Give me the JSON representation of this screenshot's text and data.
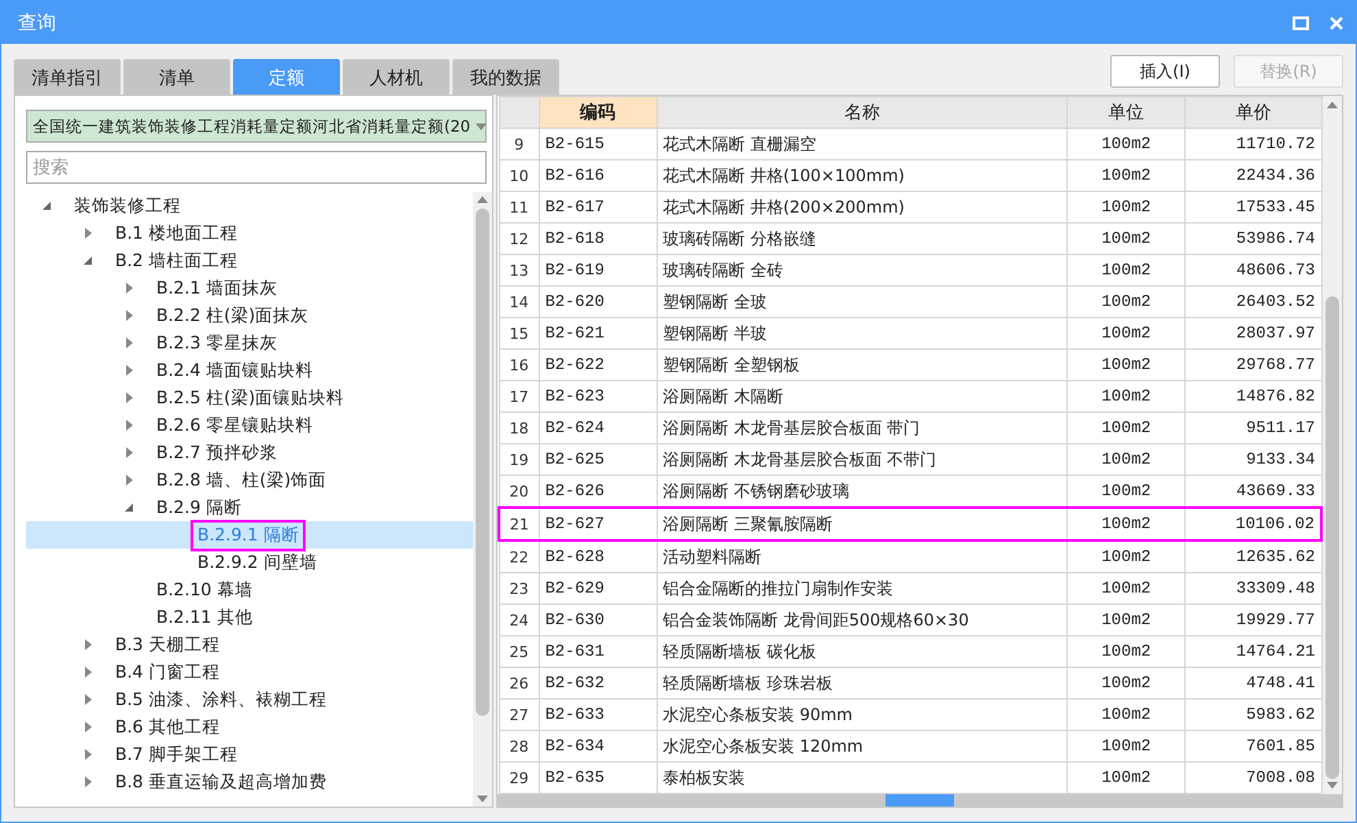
{
  "window": {
    "title": "查询"
  },
  "tabs": [
    {
      "label": "清单指引",
      "selected": false
    },
    {
      "label": "清单",
      "selected": false
    },
    {
      "label": "定额",
      "selected": true
    },
    {
      "label": "人材机",
      "selected": false
    },
    {
      "label": "我的数据",
      "selected": false
    }
  ],
  "buttons": [
    {
      "label": "插入(I)",
      "disabled": false
    },
    {
      "label": "替换(R)",
      "disabled": true
    }
  ],
  "library": {
    "value": "全国统一建筑装饰装修工程消耗量定额河北省消耗量定额(20"
  },
  "search": {
    "placeholder": "搜索"
  },
  "tree": [
    {
      "label": "装饰装修工程",
      "expanded": true,
      "selected": false,
      "marked": false,
      "children": [
        {
          "label": "B.1 楼地面工程",
          "expanded": false,
          "selected": false,
          "marked": false
        },
        {
          "label": "B.2 墙柱面工程",
          "expanded": true,
          "selected": false,
          "marked": false,
          "children": [
            {
              "label": "B.2.1 墙面抹灰",
              "expanded": false,
              "selected": false,
              "marked": false
            },
            {
              "label": "B.2.2 柱(梁)面抹灰",
              "expanded": false,
              "selected": false,
              "marked": false
            },
            {
              "label": "B.2.3 零星抹灰",
              "expanded": false,
              "selected": false,
              "marked": false
            },
            {
              "label": "B.2.4 墙面镶贴块料",
              "expanded": false,
              "selected": false,
              "marked": false
            },
            {
              "label": "B.2.5 柱(梁)面镶贴块料",
              "expanded": false,
              "selected": false,
              "marked": false
            },
            {
              "label": "B.2.6 零星镶贴块料",
              "expanded": false,
              "selected": false,
              "marked": false
            },
            {
              "label": "B.2.7 预拌砂浆",
              "expanded": false,
              "selected": false,
              "marked": false
            },
            {
              "label": "B.2.8 墙、柱(梁)饰面",
              "expanded": false,
              "selected": false,
              "marked": false
            },
            {
              "label": "B.2.9 隔断",
              "expanded": true,
              "selected": false,
              "marked": false,
              "children": [
                {
                  "label": "B.2.9.1 隔断",
                  "selected": true,
                  "marked": true
                },
                {
                  "label": "B.2.9.2 间壁墙",
                  "selected": false,
                  "marked": false
                }
              ]
            },
            {
              "label": "B.2.10 幕墙",
              "selected": false,
              "marked": false
            },
            {
              "label": "B.2.11 其他",
              "selected": false,
              "marked": false
            }
          ]
        },
        {
          "label": "B.3 天棚工程",
          "expanded": false,
          "selected": false,
          "marked": false
        },
        {
          "label": "B.4 门窗工程",
          "expanded": false,
          "selected": false,
          "marked": false
        },
        {
          "label": "B.5 油漆、涂料、裱糊工程",
          "expanded": false,
          "selected": false,
          "marked": false
        },
        {
          "label": "B.6 其他工程",
          "expanded": false,
          "selected": false,
          "marked": false
        },
        {
          "label": "B.7 脚手架工程",
          "expanded": false,
          "selected": false,
          "marked": false
        },
        {
          "label": "B.8 垂直运输及超高增加费",
          "expanded": false,
          "selected": false,
          "marked": false
        }
      ]
    }
  ],
  "table": {
    "columns": [
      {
        "label": "编码",
        "selected": true
      },
      {
        "label": "名称",
        "selected": false
      },
      {
        "label": "单位",
        "selected": false
      },
      {
        "label": "单价",
        "selected": false
      }
    ],
    "rows": [
      {
        "index": "9",
        "code": "B2-615",
        "name": "花式木隔断 直栅漏空",
        "unit": "100m2",
        "price": "11710.72",
        "marked": false
      },
      {
        "index": "10",
        "code": "B2-616",
        "name": "花式木隔断 井格(100×100mm)",
        "unit": "100m2",
        "price": "22434.36",
        "marked": false
      },
      {
        "index": "11",
        "code": "B2-617",
        "name": "花式木隔断 井格(200×200mm)",
        "unit": "100m2",
        "price": "17533.45",
        "marked": false
      },
      {
        "index": "12",
        "code": "B2-618",
        "name": "玻璃砖隔断 分格嵌缝",
        "unit": "100m2",
        "price": "53986.74",
        "marked": false
      },
      {
        "index": "13",
        "code": "B2-619",
        "name": "玻璃砖隔断 全砖",
        "unit": "100m2",
        "price": "48606.73",
        "marked": false
      },
      {
        "index": "14",
        "code": "B2-620",
        "name": "塑钢隔断 全玻",
        "unit": "100m2",
        "price": "26403.52",
        "marked": false
      },
      {
        "index": "15",
        "code": "B2-621",
        "name": "塑钢隔断 半玻",
        "unit": "100m2",
        "price": "28037.97",
        "marked": false
      },
      {
        "index": "16",
        "code": "B2-622",
        "name": "塑钢隔断 全塑钢板",
        "unit": "100m2",
        "price": "29768.77",
        "marked": false
      },
      {
        "index": "17",
        "code": "B2-623",
        "name": "浴厕隔断 木隔断",
        "unit": "100m2",
        "price": "14876.82",
        "marked": false
      },
      {
        "index": "18",
        "code": "B2-624",
        "name": "浴厕隔断 木龙骨基层胶合板面 带门",
        "unit": "100m2",
        "price": "9511.17",
        "marked": false
      },
      {
        "index": "19",
        "code": "B2-625",
        "name": "浴厕隔断 木龙骨基层胶合板面 不带门",
        "unit": "100m2",
        "price": "9133.34",
        "marked": false
      },
      {
        "index": "20",
        "code": "B2-626",
        "name": "浴厕隔断 不锈钢磨砂玻璃",
        "unit": "100m2",
        "price": "43669.33",
        "marked": false
      },
      {
        "index": "21",
        "code": "B2-627",
        "name": "浴厕隔断 三聚氰胺隔断",
        "unit": "100m2",
        "price": "10106.02",
        "marked": true
      },
      {
        "index": "22",
        "code": "B2-628",
        "name": "活动塑料隔断",
        "unit": "100m2",
        "price": "12635.62",
        "marked": false
      },
      {
        "index": "23",
        "code": "B2-629",
        "name": "铝合金隔断的推拉门扇制作安装",
        "unit": "100m2",
        "price": "33309.48",
        "marked": false
      },
      {
        "index": "24",
        "code": "B2-630",
        "name": "铝合金装饰隔断 龙骨间距500规格60×30",
        "unit": "100m2",
        "price": "19929.77",
        "marked": false
      },
      {
        "index": "25",
        "code": "B2-631",
        "name": "轻质隔断墙板 碳化板",
        "unit": "100m2",
        "price": "14764.21",
        "marked": false
      },
      {
        "index": "26",
        "code": "B2-632",
        "name": "轻质隔断墙板 珍珠岩板",
        "unit": "100m2",
        "price": "4748.41",
        "marked": false
      },
      {
        "index": "27",
        "code": "B2-633",
        "name": "水泥空心条板安装 90mm",
        "unit": "100m2",
        "price": "5983.62",
        "marked": false
      },
      {
        "index": "28",
        "code": "B2-634",
        "name": "水泥空心条板安装 120mm",
        "unit": "100m2",
        "price": "7601.85",
        "marked": false
      },
      {
        "index": "29",
        "code": "B2-635",
        "name": "泰柏板安装",
        "unit": "100m2",
        "price": "7008.08",
        "marked": false
      }
    ]
  }
}
